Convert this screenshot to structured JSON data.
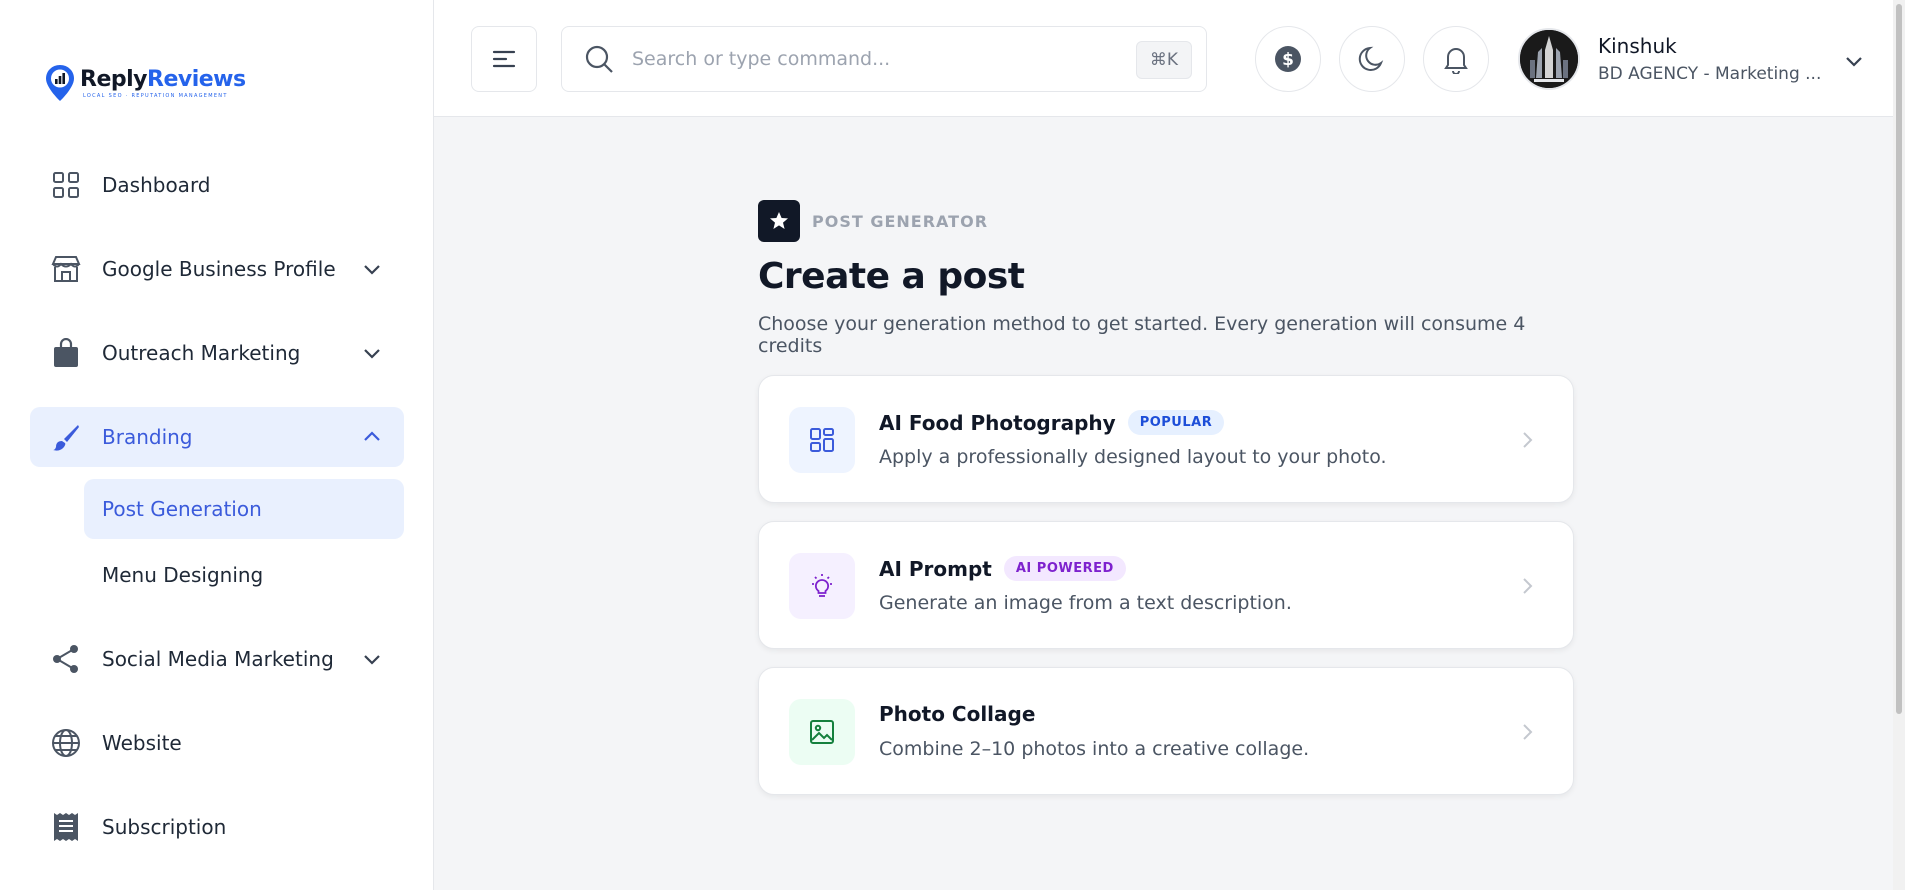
{
  "brand": {
    "word1": "Reply",
    "word2": "Reviews",
    "tagline": "LOCAL SEO · REPUTATION MANAGEMENT",
    "color": "#2563eb"
  },
  "sidebar": {
    "items": [
      {
        "label": "Dashboard",
        "icon": "dashboard-grid-icon"
      },
      {
        "label": "Google Business Profile",
        "icon": "storefront-icon"
      },
      {
        "label": "Outreach Marketing",
        "icon": "shopping-bag-icon"
      },
      {
        "label": "Branding",
        "icon": "paintbrush-icon",
        "active": true
      },
      {
        "label": "Social Media Marketing",
        "icon": "share-icon"
      },
      {
        "label": "Website",
        "icon": "globe-icon"
      },
      {
        "label": "Subscription",
        "icon": "receipt-icon"
      }
    ],
    "branding_sub": [
      {
        "label": "Post Generation",
        "active": true
      },
      {
        "label": "Menu Designing"
      }
    ]
  },
  "header": {
    "search_placeholder": "Search or type command...",
    "shortcut": "⌘K",
    "user_name": "Kinshuk",
    "user_org": "BD AGENCY - Marketing ..."
  },
  "main": {
    "eyebrow": "POST GENERATOR",
    "title": "Create a post",
    "subtitle": "Choose your generation method to get started. Every generation will consume 4 credits",
    "cards": [
      {
        "title": "AI Food Photography",
        "badge": "POPULAR",
        "desc": "Apply a professionally designed layout to your photo.",
        "icon": "layout-grid-icon"
      },
      {
        "title": "AI Prompt",
        "badge": "AI POWERED",
        "desc": "Generate an image from a text description.",
        "icon": "lightbulb-icon"
      },
      {
        "title": "Photo Collage",
        "badge": "",
        "desc": "Combine 2–10 photos into a creative collage.",
        "icon": "image-icon"
      }
    ]
  },
  "colors": {
    "accent": "#3b5bdb",
    "active_bg": "#e9f0fe",
    "badge_popular_bg": "#e6f0ff",
    "badge_popular_fg": "#1d4ed8",
    "badge_ai_bg": "#f3e8ff",
    "badge_ai_fg": "#7e22ce"
  }
}
